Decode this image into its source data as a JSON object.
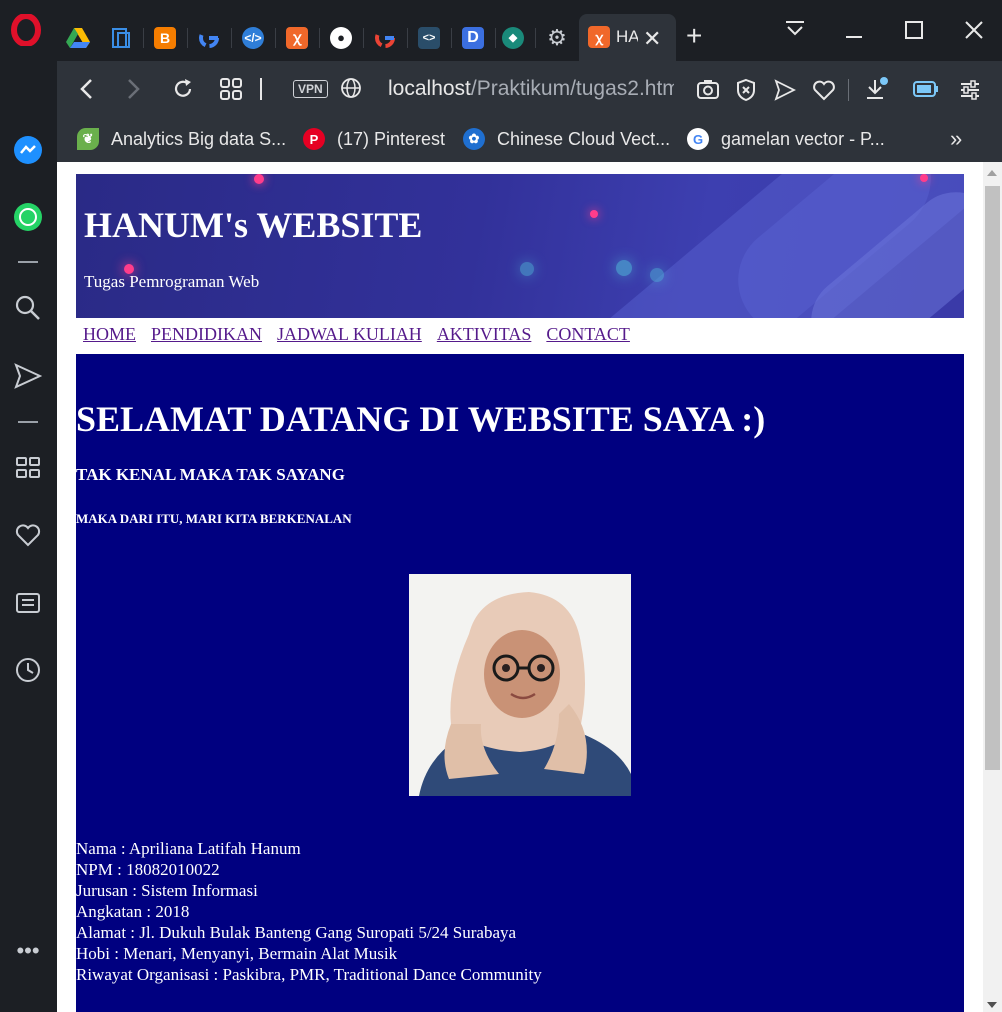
{
  "browser": {
    "active_tab_title": "HA",
    "url_host": "localhost",
    "url_path": "/Praktikum/tugas2.htm",
    "vpn_label": "VPN"
  },
  "bookmarks": [
    {
      "label": "Analytics Big data S...",
      "icon": "leaf-icon"
    },
    {
      "label": "(17) Pinterest",
      "icon": "pinterest-icon"
    },
    {
      "label": "Chinese Cloud Vect...",
      "icon": "cloud-vector-icon"
    },
    {
      "label": "gamelan vector - P...",
      "icon": "google-icon"
    }
  ],
  "site": {
    "title": "HANUM's WEBSITE",
    "subtitle": "Tugas Pemrograman Web"
  },
  "nav": [
    "HOME",
    "PENDIDIKAN",
    "JADWAL KULIAH",
    "AKTIVITAS",
    "CONTACT"
  ],
  "content": {
    "welcome": "SELAMAT DATANG DI WEBSITE SAYA :)",
    "tagline": "TAK KENAL MAKA TAK SAYANG",
    "tagline2": "MAKA DARI ITU, MARI KITA BERKENALAN",
    "bio": [
      "Nama : Apriliana Latifah Hanum",
      "NPM : 18082010022",
      "Jurusan : Sistem Informasi",
      "Angkatan : 2018",
      "Alamat : Jl. Dukuh Bulak Banteng Gang Suropati 5/24 Surabaya",
      "Hobi : Menari, Menyanyi, Bermain Alat Musik",
      "Riwayat Organisasi : Paskibra, PMR, Traditional Dance Community"
    ]
  },
  "colors": {
    "content_bg": "#000080",
    "banner_bg": "#32319a",
    "link": "#551a8b"
  }
}
